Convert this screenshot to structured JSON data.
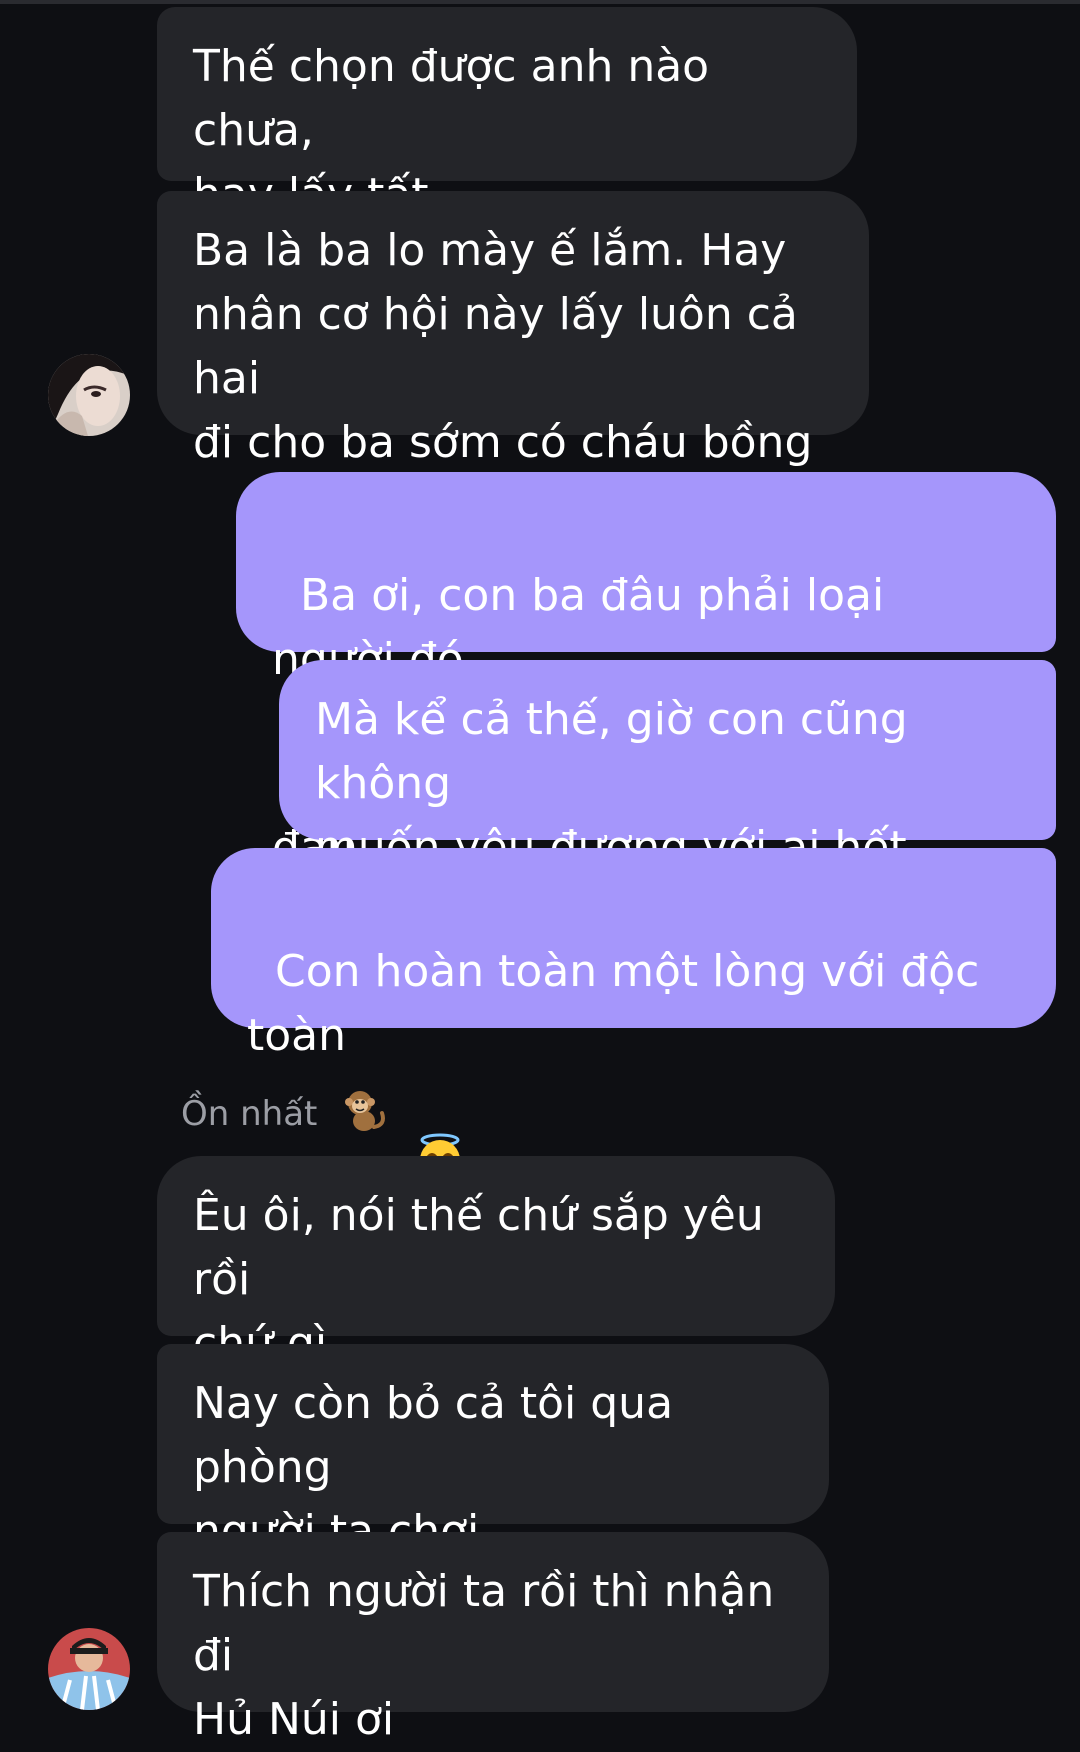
{
  "messages": [
    {
      "side": "incoming",
      "text": "Thế chọn được anh nào chưa,\nhay lấy tất"
    },
    {
      "side": "incoming",
      "text": "Ba là ba lo mày ế lắm. Hay\nnhân cơ hội này lấy luôn cả hai\nđi cho ba sớm có cháu bồng"
    },
    {
      "side": "outgoing",
      "text": "Ba ơi, con ba đâu phải loại người đó\nđâu",
      "emoji": "smiling-face-with-halo"
    },
    {
      "side": "outgoing",
      "text": "Mà kể cả thế, giờ con cũng không\nmuốn yêu đương với ai hết"
    },
    {
      "side": "outgoing",
      "text": "Con hoàn toàn một lòng với độc toàn\nthân",
      "emoji": "smiling-face-with-halo"
    },
    {
      "side": "incoming",
      "text": "Êu ôi, nói thế chứ sắp yêu rồi\nchứ gì"
    },
    {
      "side": "incoming",
      "text": "Nay còn bỏ cả tôi qua phòng\nngười ta chơi"
    },
    {
      "side": "incoming",
      "text": "Thích người ta rồi thì nhận đi\nHủ Núi ơi"
    }
  ],
  "sender_label": {
    "name": "Ồn nhất",
    "emoji": "monkey-icon"
  },
  "colors": {
    "background": "#0e0f13",
    "incoming_bubble": "#242529",
    "outgoing_bubble": "#a596fb",
    "sender_text": "#9c9ea5"
  }
}
